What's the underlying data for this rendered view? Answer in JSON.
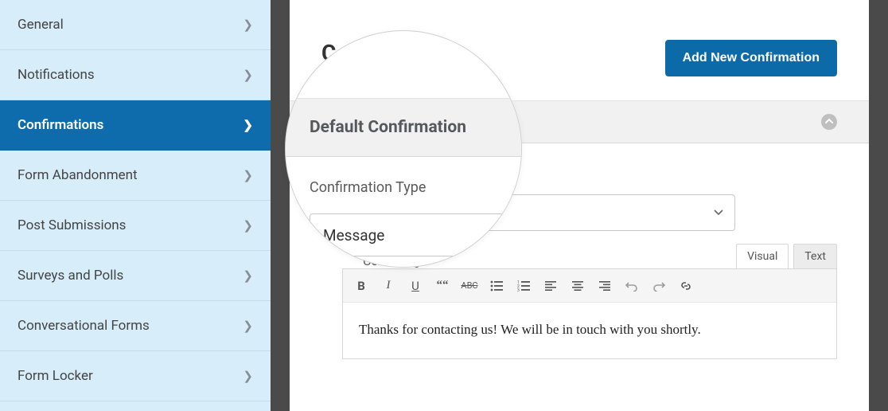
{
  "sidebar": {
    "items": [
      {
        "label": "General"
      },
      {
        "label": "Notifications"
      },
      {
        "label": "Confirmations"
      },
      {
        "label": "Form Abandonment"
      },
      {
        "label": "Post Submissions"
      },
      {
        "label": "Surveys and Polls"
      },
      {
        "label": "Conversational Forms"
      },
      {
        "label": "Form Locker"
      }
    ]
  },
  "main": {
    "title": "Confirmations",
    "add_button": "Add New Confirmation",
    "section_title": "Default Confirmation",
    "type_label": "Confirmation Type",
    "type_value": "Message",
    "message_label": "Confirmation Message",
    "message_label_partial": "Conf                      ssage",
    "tabs": {
      "visual": "Visual",
      "text": "Text"
    },
    "editor_body": "Thanks for contacting us! We will be in touch with you shortly."
  },
  "colors": {
    "primary": "#0d6aa8",
    "sidebar_bg": "#d7edf9"
  }
}
